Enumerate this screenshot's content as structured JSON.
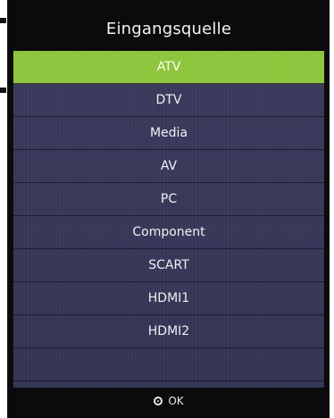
{
  "title": "Eingangsquelle",
  "items": [
    {
      "label": "ATV",
      "selected": true
    },
    {
      "label": "DTV"
    },
    {
      "label": "Media"
    },
    {
      "label": "AV"
    },
    {
      "label": "PC"
    },
    {
      "label": "Component"
    },
    {
      "label": "SCART"
    },
    {
      "label": "HDMI1"
    },
    {
      "label": "HDMI2"
    },
    {
      "label": ""
    }
  ],
  "footer": {
    "ok_label": "OK",
    "icon": "ok-button-icon"
  },
  "colors": {
    "selected": "#8dc53c",
    "list_bg": "#3a3a5c",
    "panel_bg": "#0b0b0e"
  }
}
